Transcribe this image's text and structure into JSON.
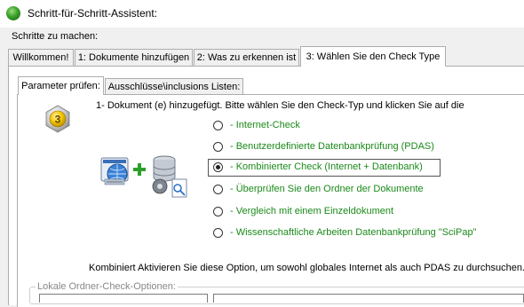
{
  "window": {
    "title": "Schritt-für-Schritt-Assistent:"
  },
  "steps_label": "Schritte zu machen:",
  "outer_tabs": [
    {
      "label": "Willkommen!"
    },
    {
      "label": "1: Dokumente hinzufügen"
    },
    {
      "label": "2: Was zu erkennen ist"
    },
    {
      "label": "3: Wählen Sie den Check Type"
    }
  ],
  "inner_tabs": [
    {
      "label": "Parameter prüfen:"
    },
    {
      "label": "Ausschlüsse\\inclusions Listen:"
    }
  ],
  "step_number": "3",
  "intro": "1- Dokument (e) hinzugefügt. Bitte wählen Sie den Check-Typ und klicken Sie auf die",
  "options": [
    {
      "label": "- Internet-Check",
      "checked": false
    },
    {
      "label": "- Benutzerdefinierte Datenbankprüfung (PDAS)",
      "checked": false
    },
    {
      "label": "- Kombinierter Check (Internet + Datenbank)",
      "checked": true
    },
    {
      "label": "- Überprüfen Sie den Ordner der Dokumente",
      "checked": false
    },
    {
      "label": "- Vergleich mit einem Einzeldokument",
      "checked": false
    },
    {
      "label": "- Wissenschaftliche Arbeiten Datenbankprüfung \"SciPap\"",
      "checked": false
    }
  ],
  "description": "Kombiniert Aktivieren Sie diese Option, um sowohl globales Internet als auch PDAS zu durchsuchen.",
  "local_group_label": "Lokale Ordner-Check-Optionen:",
  "colors": {
    "option_text": "#1a8a1a",
    "badge_outer": "#c9c9c9",
    "badge_inner": "#f2c200"
  },
  "icons": {
    "app": "app-logo-icon",
    "badge": "step-number-badge-icon",
    "globe_doc": "globe-document-icon",
    "plus": "plus-icon",
    "database": "database-icon"
  }
}
